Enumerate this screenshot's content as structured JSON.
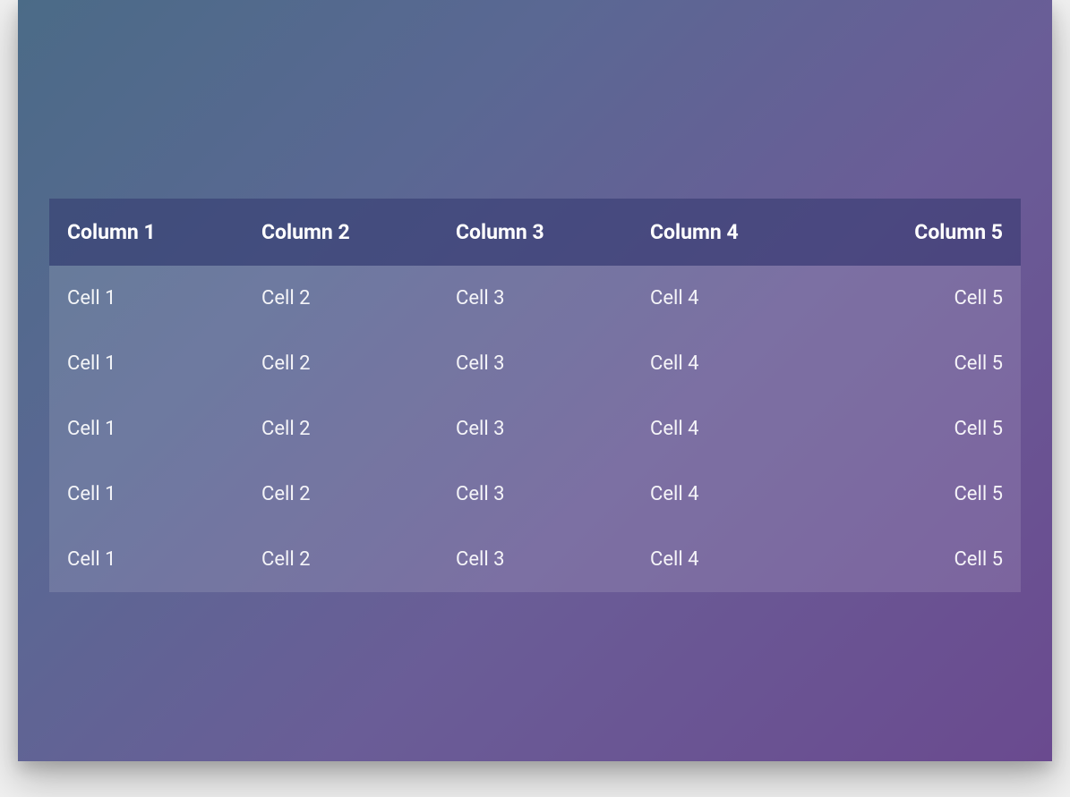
{
  "table": {
    "columns": [
      "Column 1",
      "Column 2",
      "Column 3",
      "Column 4",
      "Column 5"
    ],
    "rows": [
      [
        "Cell 1",
        "Cell 2",
        "Cell 3",
        "Cell 4",
        "Cell 5"
      ],
      [
        "Cell 1",
        "Cell 2",
        "Cell 3",
        "Cell 4",
        "Cell 5"
      ],
      [
        "Cell 1",
        "Cell 2",
        "Cell 3",
        "Cell 4",
        "Cell 5"
      ],
      [
        "Cell 1",
        "Cell 2",
        "Cell 3",
        "Cell 4",
        "Cell 5"
      ],
      [
        "Cell 1",
        "Cell 2",
        "Cell 3",
        "Cell 4",
        "Cell 5"
      ]
    ]
  }
}
